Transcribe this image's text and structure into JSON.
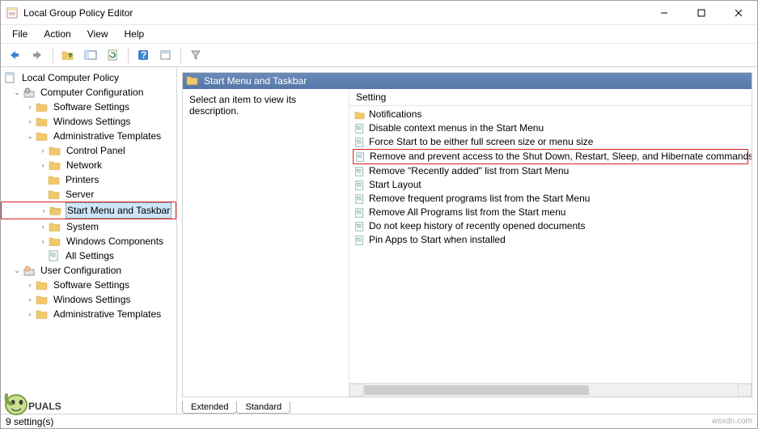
{
  "window": {
    "title": "Local Group Policy Editor"
  },
  "menu": {
    "file": "File",
    "action": "Action",
    "view": "View",
    "help": "Help"
  },
  "tree": {
    "root": "Local Computer Policy",
    "computer_config": "Computer Configuration",
    "cc_software": "Software Settings",
    "cc_windows": "Windows Settings",
    "cc_admin": "Administrative Templates",
    "cc_control_panel": "Control Panel",
    "cc_network": "Network",
    "cc_printers": "Printers",
    "cc_server": "Server",
    "cc_start_menu": "Start Menu and Taskbar",
    "cc_system": "System",
    "cc_windows_comp": "Windows Components",
    "cc_all_settings": "All Settings",
    "user_config": "User Configuration",
    "uc_software": "Software Settings",
    "uc_windows": "Windows Settings",
    "uc_admin": "Administrative Templates"
  },
  "pane": {
    "title": "Start Menu and Taskbar",
    "desc_prompt": "Select an item to view its description.",
    "column_header": "Setting"
  },
  "settings": [
    {
      "text": "Notifications",
      "type": "folder"
    },
    {
      "text": "Disable context menus in the Start Menu",
      "type": "policy"
    },
    {
      "text": "Force Start to be either full screen size or menu size",
      "type": "policy"
    },
    {
      "text": "Remove and prevent access to the Shut Down, Restart, Sleep, and Hibernate commands",
      "type": "policy",
      "highlight": true
    },
    {
      "text": "Remove \"Recently added\" list from Start Menu",
      "type": "policy"
    },
    {
      "text": "Start Layout",
      "type": "policy"
    },
    {
      "text": "Remove frequent programs list from the Start Menu",
      "type": "policy"
    },
    {
      "text": "Remove All Programs list from the Start menu",
      "type": "policy"
    },
    {
      "text": "Do not keep history of recently opened documents",
      "type": "policy"
    },
    {
      "text": "Pin Apps to Start when installed",
      "type": "policy"
    }
  ],
  "tabs": {
    "extended": "Extended",
    "standard": "Standard"
  },
  "status": {
    "text": "9 setting(s)",
    "watermark": "wsxdn.com"
  }
}
